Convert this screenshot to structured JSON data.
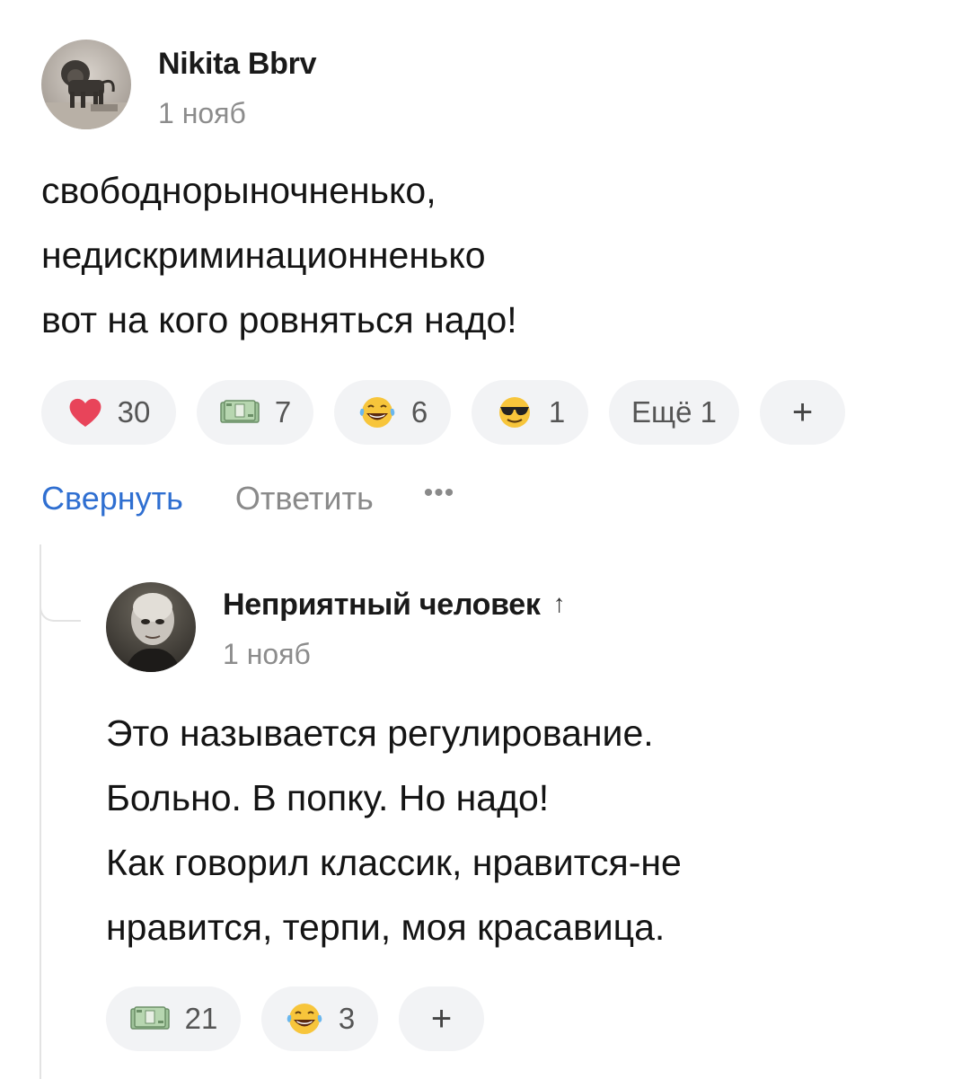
{
  "comments": [
    {
      "author": "Nikita Bbrv",
      "date": "1 нояб",
      "text_lines": [
        "свободнорыночненько,",
        "недискриминационненько",
        "вот на кого ровняться надо!"
      ],
      "reactions": [
        {
          "icon": "heart-icon",
          "count": "30"
        },
        {
          "icon": "money-icon",
          "count": "7"
        },
        {
          "icon": "laughing-tears-emoji",
          "count": "6"
        },
        {
          "icon": "sunglasses-emoji",
          "count": "1"
        },
        {
          "label": "Ещё 1"
        },
        {
          "label": "+"
        }
      ],
      "actions": {
        "collapse": "Свернуть",
        "reply": "Ответить",
        "more": "•••"
      }
    },
    {
      "author": "Неприятный человек",
      "author_badge_icon": "up-arrow-icon",
      "author_badge": "↑",
      "date": "1 нояб",
      "text_lines": [
        "Это называется регулирование.",
        "Больно. В попку. Но надо!",
        "Как говорил классик, нравится-не",
        "нравится, терпи, моя красавица."
      ],
      "reactions": [
        {
          "icon": "money-icon",
          "count": "21"
        },
        {
          "icon": "laughing-tears-emoji",
          "count": "3"
        },
        {
          "label": "+"
        }
      ]
    }
  ],
  "colors": {
    "link": "#2f6fd1",
    "muted": "#8a8a8a",
    "pill_bg": "#f2f3f5",
    "heart": "#e8445a"
  }
}
